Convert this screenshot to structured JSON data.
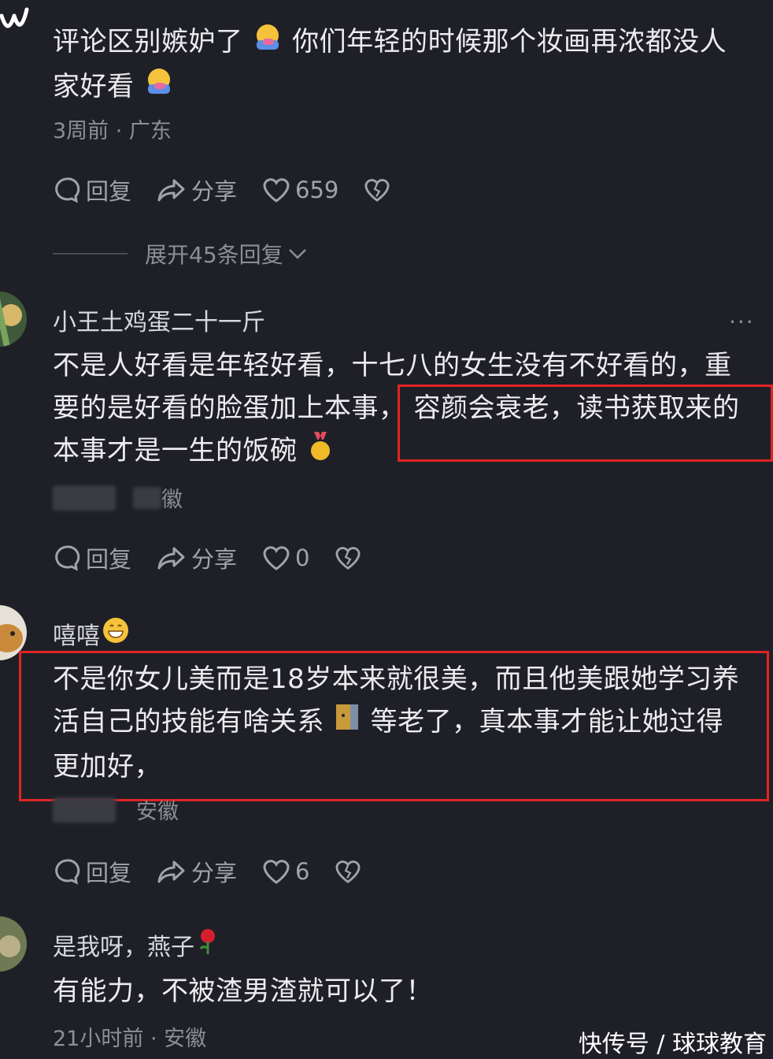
{
  "comments": [
    {
      "text_lines": [
        "评论区别嫉妒了",
        "你们年轻的时候那个妆画再浓都没人",
        "家好看"
      ],
      "meta": "3周前 · 广东",
      "reply_label": "回复",
      "share_label": "分享",
      "like_count": "659",
      "expand_label": "展开45条回复"
    },
    {
      "author": "小王土鸡蛋二十一斤",
      "text_lines": [
        "不是人好看是年轻好看，十七八的女生没有不好看的，重",
        "要的是好看的脸蛋加上本事，",
        "容颜会衰老，读书获取来的",
        "本事才是一生的饭碗"
      ],
      "meta_visible": "徽",
      "reply_label": "回复",
      "share_label": "分享",
      "like_count": "0"
    },
    {
      "author": "嘻嘻",
      "text_lines": [
        "不是你女儿美而是18岁本来就很美，而且他美跟她学习养",
        "活自己的技能有啥关系",
        "等老了，真本事才能让她过得",
        "更加好，"
      ],
      "meta_visible": "安徽",
      "reply_label": "回复",
      "share_label": "分享",
      "like_count": "6"
    },
    {
      "author": "是我呀，燕子",
      "text_lines": [
        "有能力，不被渣男渣就可以了！"
      ],
      "meta": "21小时前 · 安徽"
    }
  ],
  "watermark": "快传号 / 球球教育",
  "colors": {
    "background": "#1f2027",
    "highlight_box": "#e02424",
    "text": "#ececef",
    "meta": "#8d8e96"
  }
}
